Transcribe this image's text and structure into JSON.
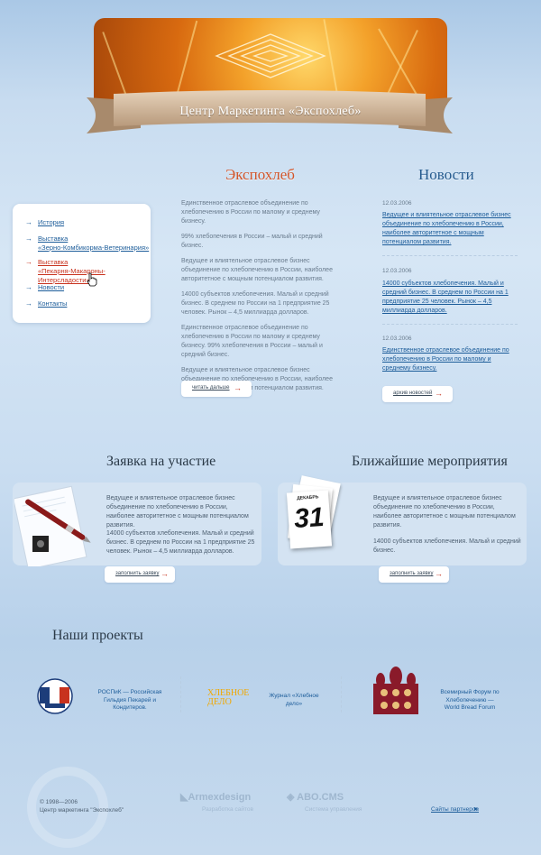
{
  "header": {
    "site_title": "Центр Маркетинга «Экспохлеб»"
  },
  "sections": {
    "company_title": "Экспохлеб",
    "news_title": "Новости",
    "application_title": "Заявка на участие",
    "events_title": "Ближайшие мероприятия",
    "projects_title": "Наши проекты"
  },
  "nav": {
    "items": [
      {
        "label": "История"
      },
      {
        "label": "Выставка\n«Зерно-Комбикорма-Ветеринария»"
      },
      {
        "label": "Выставка\n«Пекарня-Макароны-Интерсладости»"
      },
      {
        "label": "Новости"
      },
      {
        "label": "Контакты"
      }
    ]
  },
  "company": {
    "paragraphs": [
      "Единственное отраслевое объединение по хлебопечению в России по малому и среднему бизнесу.",
      "99% хлебопечения в России – малый и средний бизнес.",
      "Ведущее и влиятельное отраслевое бизнес объединение по хлебопечению в России, наиболее авторитетное с мощным потенциалом развития.",
      "14000 субъектов хлебопечения. Малый и средний бизнес. В среднем по России на 1 предприятие 25 человек. Рынок – 4,5 миллиарда долларов.",
      "Единственное отраслевое объединение по хлебопечению в России по малому и среднему бизнесу. 99% хлебопечения в России – малый и средний бизнес.",
      "Ведущее и влиятельное отраслевое бизнес объединение по хлебопечению в России, наиболее авторитетное с мощным потенциалом развития."
    ],
    "read_more": "читать дальше"
  },
  "news": {
    "items": [
      {
        "date": "12.03.2006",
        "text": "Ведущее и влиятельное отраслевое бизнес объединение по хлебопечению в России, наиболее авторитетное с мощным потенциалом развития."
      },
      {
        "date": "12.03.2006",
        "text": "14000 субъектов хлебопечения. Малый и средний бизнес. В среднем по России на 1 предприятие 25 человек. Рынок – 4,5 миллиарда долларов."
      },
      {
        "date": "12.03.2006",
        "text": "Единственное отраслевое объединение по хлебопечению в России по малому и среднему бизнесу."
      }
    ],
    "archive": "архив новостей"
  },
  "application": {
    "p1": "Ведущее и влиятельное отраслевое бизнес объединение по хлебопечению в России, наиболее авторитетное с мощным потенциалом развития.",
    "p2": "14000 субъектов хлебопечения. Малый и средний бизнес. В среднем по России на 1 предприятие 25 человек. Рынок – 4,5 миллиарда долларов.",
    "button": "заполнить заявку"
  },
  "events": {
    "calendar_month": "ДЕКАБРЬ",
    "calendar_day": "31",
    "p1": "Ведущее и влиятельное отраслевое бизнес объединение по хлебопечению в России, наиболее авторитетное с мощным потенциалом развития.",
    "p2": "14000 субъектов хлебопечения. Малый и средний бизнес.",
    "button": "заполнить заявку"
  },
  "projects": {
    "rospik_text": "РОСПиК — Российская Гильдия Пекарей и Кондитеров.",
    "hleb_logo": "ХЛЕБНОЕ ДЕЛО",
    "hleb_text": "Журнал «Хлебное дело»",
    "forum_text": "Всемирный Форум по Хлебопечению — World Bread Forum"
  },
  "footer": {
    "copyright": "© 1998—2006\nЦентр маркетинга \"Экспохлеб\"",
    "armex": "Armexdesign",
    "armex_sub": "Разработка сайтов",
    "abo": "ABO.CMS",
    "abo_sub": "Система управления",
    "partners": "Сайты партнеров"
  },
  "colors": {
    "accent": "#c8321e",
    "link": "#1d5d9a",
    "news_title": "#245a8e",
    "company_title": "#d2552a"
  }
}
